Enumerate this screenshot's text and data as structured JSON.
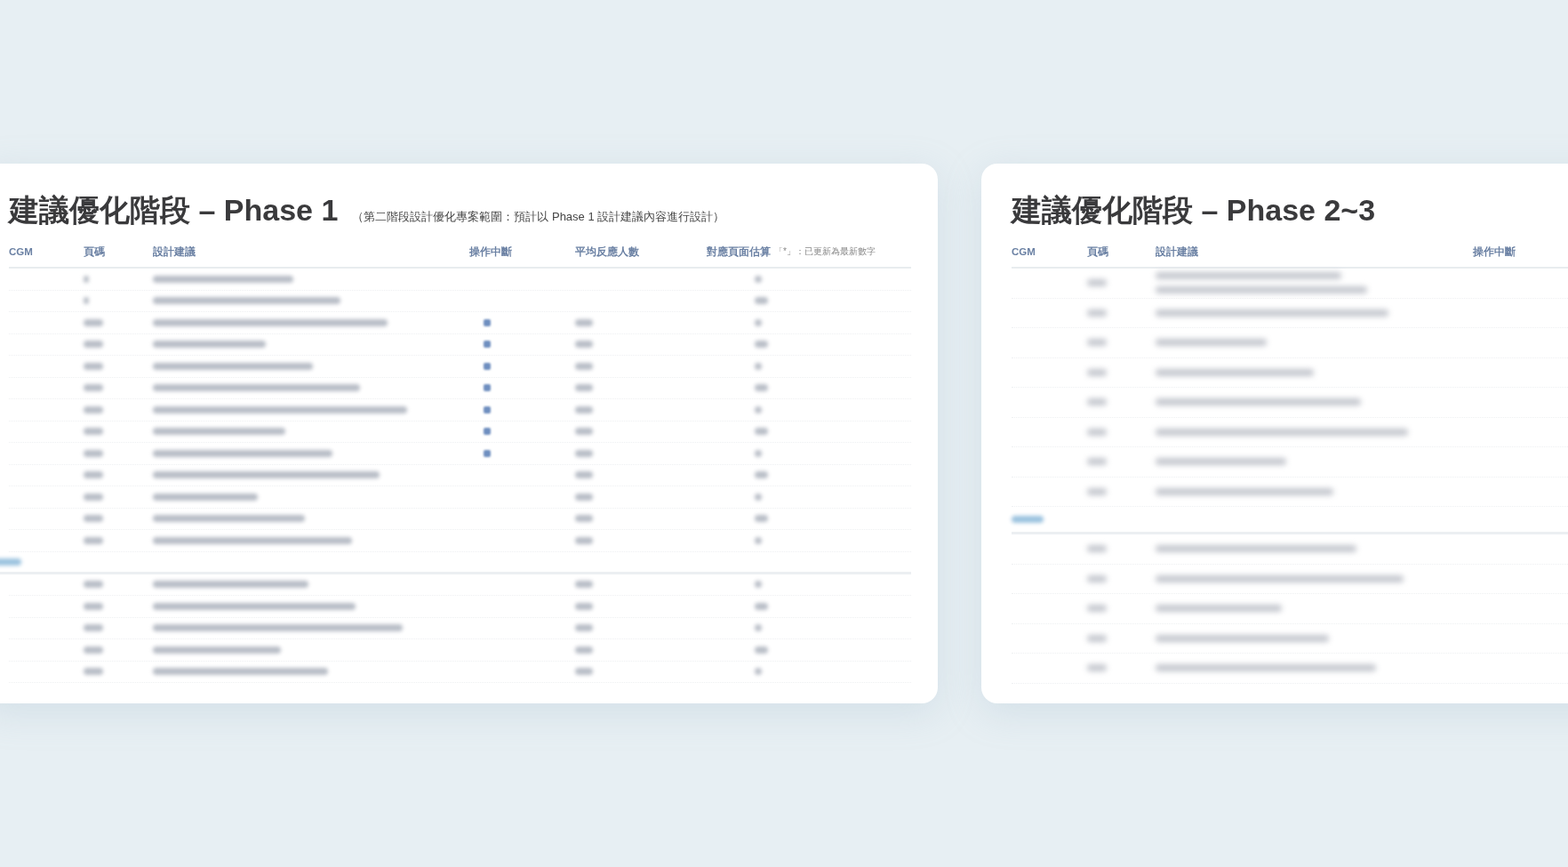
{
  "panels": [
    {
      "title": "建議優化階段 – Phase 1",
      "subtitle": "（第二階段設計優化專案範圍：預計以 Phase 1 設計建議內容進行設計）",
      "columns": [
        "CGM",
        "頁碼",
        "設計建議",
        "操作中斷",
        "平均反應人數",
        "對應頁面估算"
      ],
      "column_note": "「*」：已更新為最新數字",
      "sections": [
        {
          "rows": [
            {
              "marked": false
            },
            {
              "marked": false
            },
            {
              "marked": true
            },
            {
              "marked": true
            },
            {
              "marked": true
            },
            {
              "marked": true
            },
            {
              "marked": true
            },
            {
              "marked": true
            },
            {
              "marked": true
            },
            {
              "marked": false
            },
            {
              "marked": false
            },
            {
              "marked": false
            },
            {
              "marked": false
            }
          ]
        },
        {
          "rows": [
            {
              "marked": false
            },
            {
              "marked": false
            },
            {
              "marked": false
            },
            {
              "marked": false
            },
            {
              "marked": false
            }
          ]
        }
      ]
    },
    {
      "title": "建議優化階段 – Phase 2~3",
      "columns": [
        "CGM",
        "頁碼",
        "設計建議",
        "操作中斷"
      ],
      "sections": [
        {
          "rows": [
            {
              "wrapped": true
            },
            {
              "wrapped": false
            },
            {
              "wrapped": false
            },
            {
              "wrapped": false
            },
            {
              "wrapped": false
            },
            {
              "wrapped": false
            },
            {
              "wrapped": false
            },
            {
              "wrapped": false
            }
          ]
        },
        {
          "rows": [
            {
              "wrapped": false
            },
            {
              "wrapped": false
            },
            {
              "wrapped": false
            },
            {
              "wrapped": false
            },
            {
              "wrapped": false
            }
          ]
        }
      ]
    }
  ]
}
